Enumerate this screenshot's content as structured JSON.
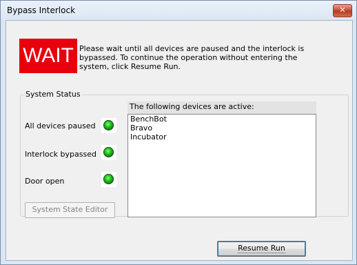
{
  "window": {
    "title": "Bypass Interlock"
  },
  "banner": {
    "wait_label": "WAIT",
    "message": "Please wait until all devices are paused and the interlock is bypassed. To continue the operation without entering the system, click Resume Run."
  },
  "system_status": {
    "group_label": "System Status",
    "items": [
      {
        "label": "All devices paused",
        "indicator": "green"
      },
      {
        "label": "Interlock bypassed",
        "indicator": "green"
      },
      {
        "label": "Door open",
        "indicator": "green"
      }
    ],
    "editor_button": "System State Editor"
  },
  "devices": {
    "header": "The following devices are active:",
    "list": [
      "BenchBot",
      "Bravo",
      "Incubator"
    ]
  },
  "actions": {
    "resume_button": "Resume Run"
  },
  "colors": {
    "wait_bg": "#e8000c",
    "indicator_green": "#1ec21a"
  }
}
